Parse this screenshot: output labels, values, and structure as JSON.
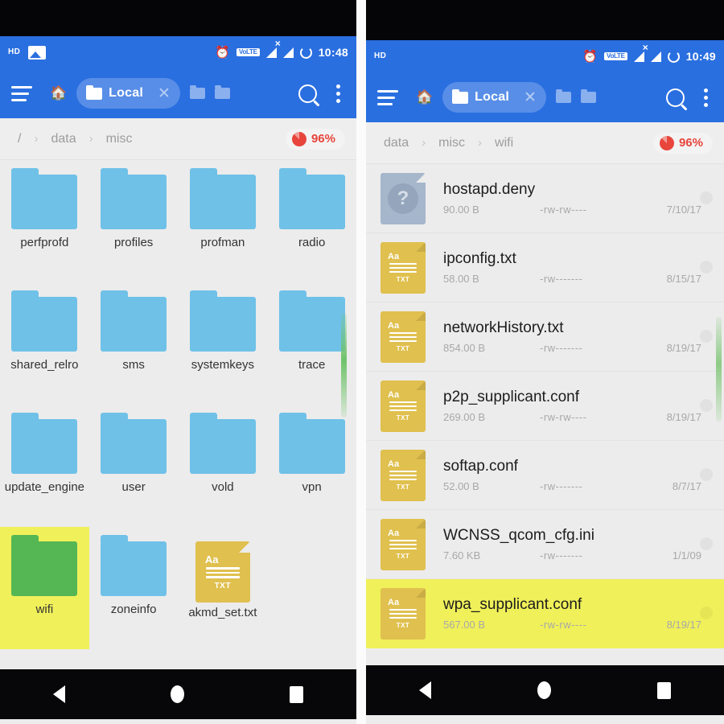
{
  "app": {
    "accent_blue": "#2a6fe0",
    "selection_yellow": "#f0f05a",
    "folder_blue": "#6fc1e8",
    "folder_green": "#55b754",
    "file_yellow": "#e0c04e",
    "storage_red": "#e8453c"
  },
  "left": {
    "statusbar": {
      "hd": "HD",
      "picture_icon": "picture-icon",
      "alarm_icon": "alarm-icon",
      "volte": "VoLTE",
      "signal1_icon": "signal-no-service-icon",
      "signal2_icon": "signal-bars-icon",
      "sync_icon": "sync-ring-icon",
      "time": "10:48"
    },
    "appbar": {
      "menu_icon": "hamburger-menu-icon",
      "home_icon": "home-icon",
      "tab_label": "Local",
      "tab_folder_icon": "folder-icon",
      "tab_close_icon": "close-icon",
      "search_icon": "search-icon",
      "overflow_icon": "overflow-menu-icon"
    },
    "breadcrumb": {
      "items": [
        "/",
        "data",
        "misc"
      ],
      "separator": "›",
      "storage_pct": "96%"
    },
    "items": [
      {
        "name": "perfprofd",
        "type": "folder",
        "selected": false
      },
      {
        "name": "profiles",
        "type": "folder",
        "selected": false
      },
      {
        "name": "profman",
        "type": "folder",
        "selected": false
      },
      {
        "name": "radio",
        "type": "folder",
        "selected": false
      },
      {
        "name": "shared_relro",
        "type": "folder",
        "selected": false
      },
      {
        "name": "sms",
        "type": "folder",
        "selected": false
      },
      {
        "name": "systemkeys",
        "type": "folder",
        "selected": false
      },
      {
        "name": "trace",
        "type": "folder",
        "selected": false
      },
      {
        "name": "update_engine",
        "type": "folder",
        "selected": false
      },
      {
        "name": "user",
        "type": "folder",
        "selected": false
      },
      {
        "name": "vold",
        "type": "folder",
        "selected": false
      },
      {
        "name": "vpn",
        "type": "folder",
        "selected": false
      },
      {
        "name": "wifi",
        "type": "folder",
        "selected": true
      },
      {
        "name": "zoneinfo",
        "type": "folder",
        "selected": false
      },
      {
        "name": "akmd_set.txt",
        "type": "txt",
        "selected": false
      }
    ],
    "file_icon_text": {
      "aa": "Aa",
      "tag": "TXT"
    },
    "navbar": {
      "back": "back-button",
      "home": "home-button",
      "recents": "recents-button"
    }
  },
  "right": {
    "statusbar": {
      "hd": "HD",
      "alarm_icon": "alarm-icon",
      "volte": "VoLTE",
      "signal1_icon": "signal-no-service-icon",
      "signal2_icon": "signal-bars-icon",
      "sync_icon": "sync-ring-icon",
      "time": "10:49"
    },
    "appbar": {
      "menu_icon": "hamburger-menu-icon",
      "home_icon": "home-icon",
      "tab_label": "Local",
      "tab_folder_icon": "folder-icon",
      "tab_close_icon": "close-icon",
      "search_icon": "search-icon",
      "overflow_icon": "overflow-menu-icon"
    },
    "breadcrumb": {
      "items": [
        "data",
        "misc",
        "wifi"
      ],
      "separator": "›",
      "storage_pct": "96%"
    },
    "files": [
      {
        "name": "hostapd.deny",
        "size": "90.00 B",
        "perm": "-rw-rw----",
        "date": "7/10/17",
        "icon": "unknown",
        "selected": false
      },
      {
        "name": "ipconfig.txt",
        "size": "58.00 B",
        "perm": "-rw-------",
        "date": "8/15/17",
        "icon": "txt",
        "selected": false
      },
      {
        "name": "networkHistory.txt",
        "size": "854.00 B",
        "perm": "-rw-------",
        "date": "8/19/17",
        "icon": "txt",
        "selected": false
      },
      {
        "name": "p2p_supplicant.conf",
        "size": "269.00 B",
        "perm": "-rw-rw----",
        "date": "8/19/17",
        "icon": "txt",
        "selected": false
      },
      {
        "name": "softap.conf",
        "size": "52.00 B",
        "perm": "-rw-------",
        "date": "8/7/17",
        "icon": "txt",
        "selected": false
      },
      {
        "name": "WCNSS_qcom_cfg.ini",
        "size": "7.60 KB",
        "perm": "-rw-------",
        "date": "1/1/09",
        "icon": "txt",
        "selected": false
      },
      {
        "name": "wpa_supplicant.conf",
        "size": "567.00 B",
        "perm": "-rw-rw----",
        "date": "8/19/17",
        "icon": "txt",
        "selected": true
      }
    ],
    "file_icon_text": {
      "aa": "Aa",
      "tag": "TXT",
      "unknown": "?"
    },
    "navbar": {
      "back": "back-button",
      "home": "home-button",
      "recents": "recents-button"
    }
  }
}
